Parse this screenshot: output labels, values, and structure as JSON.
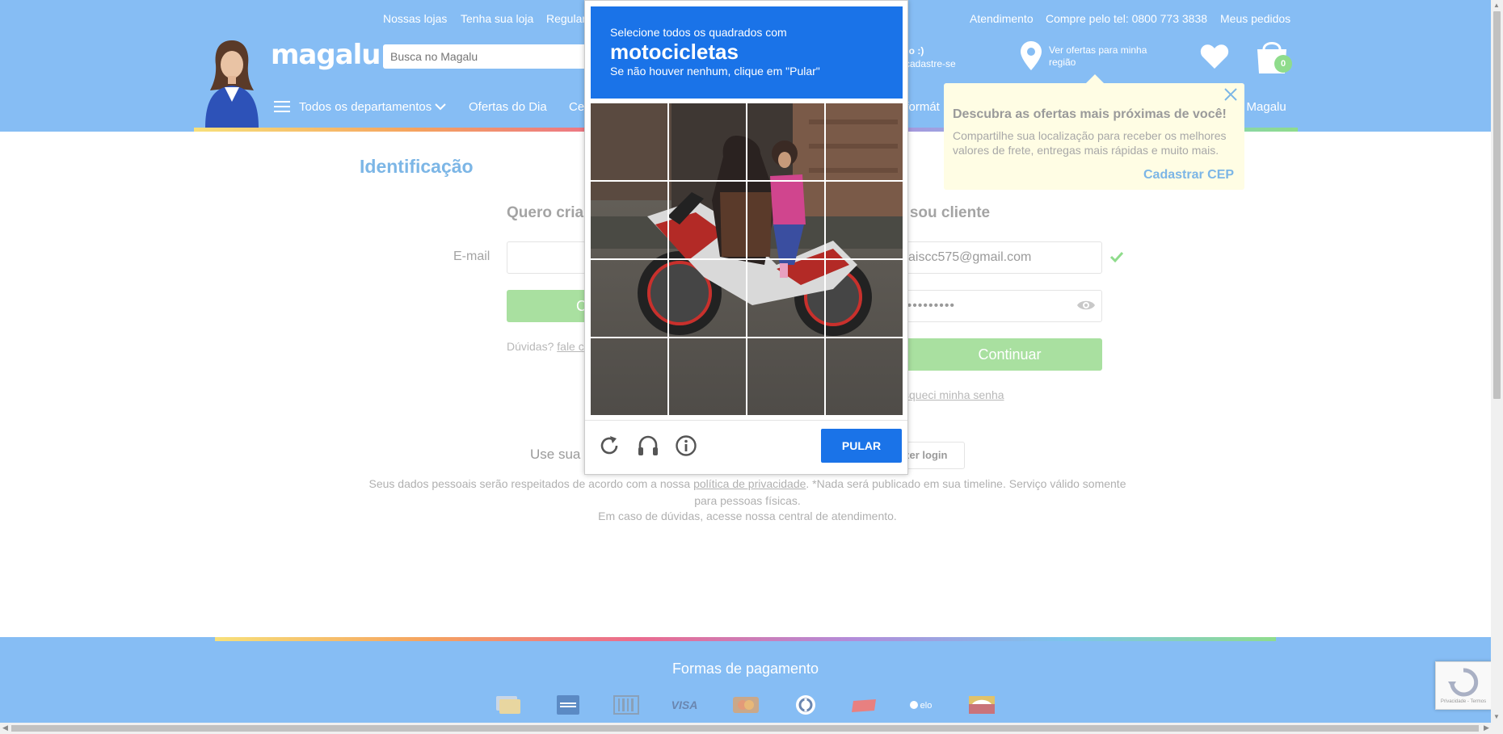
{
  "top_links": {
    "nossas_lojas": "Nossas lojas",
    "tenha_sua_loja": "Tenha sua loja",
    "regular": "Regular",
    "atendimento": "Atendimento",
    "compre_tel": "Compre pelo tel: 0800 773 3838",
    "meus_pedidos": "Meus pedidos"
  },
  "header": {
    "logo": "magalu",
    "search_placeholder": "Busca no Magalu",
    "greeting_line1": "ndo :)",
    "greeting_line2": "u cadastre-se",
    "location_text": "Ver ofertas para minha região",
    "cart_count": "0"
  },
  "nav": {
    "all_departments": "Todos os departamentos",
    "ofertas_do_dia": "Ofertas do Dia",
    "ce": "Ce",
    "informat": "nformát",
    "magalu": "o Magalu"
  },
  "main": {
    "page_title": "Identificação",
    "new_customer_title": "Quero criar",
    "email_label": "E-mail",
    "new_continue_label": "C",
    "doubts_prefix": "Dúvidas? ",
    "doubts_link": "fale c",
    "client_title": "á sou cliente",
    "client_email": "aiscc575@gmail.com",
    "client_password": "••••••••••",
    "client_continue": "Continuar",
    "forgot_password": "squeci minha senha",
    "social_text": "Use sua r",
    "social_login": "zer login",
    "privacy_prefix": "Seus dados pessoais serão respeitados de acordo com a nossa ",
    "privacy_link": "política de privacidade",
    "privacy_suffix": ". *Nada será publicado em sua timeline. Serviço válido somente para pessoas físicas.",
    "help_text": "Em caso de dúvidas, acesse nossa central de atendimento."
  },
  "cep_popup": {
    "title": "Descubra as ofertas mais próximas de você!",
    "description": "Compartilhe sua localização para receber os melhores valores de frete, entregas mais rápidas e muito mais.",
    "link": "Cadastrar CEP"
  },
  "captcha": {
    "instruction": "Selecione todos os quadrados com",
    "target": "motocicletas",
    "hint": "Se não houver nenhum, clique em \"Pular\"",
    "skip_button": "PULAR",
    "tiles": [
      "1",
      "2",
      "3",
      "4",
      "5",
      "6",
      "7",
      "8",
      "9",
      "10",
      "11",
      "12",
      "13",
      "14",
      "15",
      "16"
    ]
  },
  "footer": {
    "payment_title": "Formas de pagamento",
    "payment_methods": [
      "magalu-card-icon",
      "amex-icon",
      "boleto-icon",
      "visa-icon",
      "mastercard-icon",
      "diners-icon",
      "hipercard-icon",
      "elo-icon",
      "aura-icon"
    ],
    "visa_label": "VISA",
    "elo_label": "elo"
  },
  "recaptcha": {
    "terms": "Privacidade - Termos"
  },
  "colors": {
    "header_bg": "#86bdf4",
    "captcha_blue": "#1a73e8",
    "button_green": "#a9e0a0",
    "popup_bg": "#fffde4"
  }
}
